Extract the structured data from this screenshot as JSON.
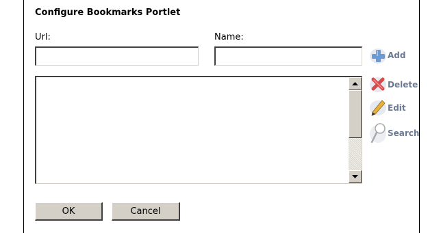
{
  "dialog": {
    "title": "Configure Bookmarks Portlet"
  },
  "form": {
    "url_label": "Url:",
    "url_value": "",
    "name_label": "Name:",
    "name_value": ""
  },
  "bookmarks_list": {
    "items": []
  },
  "actions": [
    {
      "label": "Add",
      "icon": "add-icon"
    },
    {
      "label": "Delete",
      "icon": "delete-icon"
    },
    {
      "label": "Edit",
      "icon": "edit-icon"
    },
    {
      "label": "Search",
      "icon": "search-icon"
    }
  ],
  "buttons": {
    "ok_label": "OK",
    "cancel_label": "Cancel"
  },
  "colors": {
    "action_text": "#6a7a93",
    "add_icon": "#6b9bd6",
    "delete_icon": "#d64a4a",
    "button_face": "#d4d0c8"
  }
}
